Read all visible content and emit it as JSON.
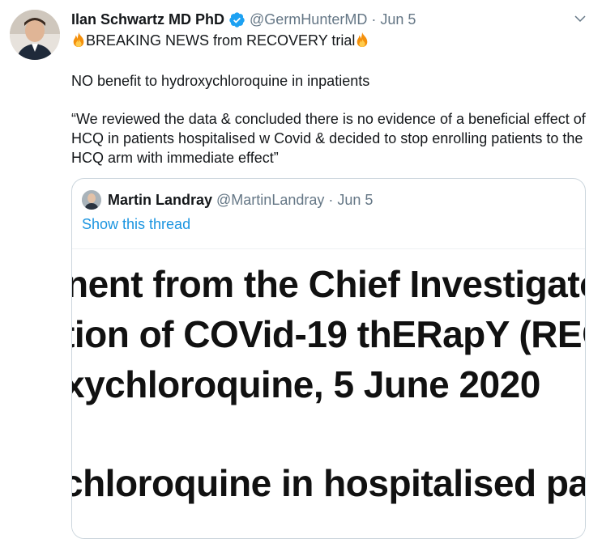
{
  "tweet": {
    "author_name": "Ilan Schwartz MD PhD",
    "handle": "@GermHunterMD",
    "separator": "·",
    "date": "Jun 5",
    "headline": "BREAKING NEWS from RECOVERY trial",
    "line2": "NO benefit to hydroxychloroquine in inpatients",
    "quote_text": "“We reviewed the data & concluded there is no evidence of a beneficial effect of HCQ in patients hospitalised w Covid & decided to stop enrolling patients to the HCQ arm with immediate effect”"
  },
  "quoted_tweet": {
    "author_name": "Martin Landray",
    "handle": "@MartinLandray",
    "separator": "·",
    "date": "Jun 5",
    "show_thread": "Show this thread",
    "image_lines": [
      "nent from the Chief Investigato",
      "tion of COVid-19 thERapY (REC",
      "xychloroquine, 5 June 2020",
      "chloroquine in hospitalised pat"
    ]
  },
  "colors": {
    "accent": "#1b95e0",
    "muted": "#657786",
    "text": "#14171a",
    "verified": "#1da1f2"
  },
  "icons": [
    "verified-badge-icon",
    "chevron-down-icon",
    "fire-emoji-icon"
  ]
}
